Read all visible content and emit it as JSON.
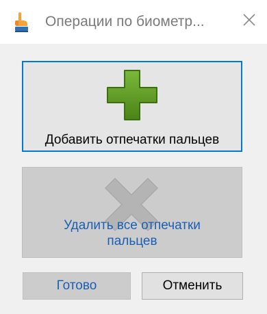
{
  "window": {
    "title": "Операции по биометр...",
    "app_icon": "finger-icon",
    "close_icon": "close-icon"
  },
  "buttons": {
    "add_fingerprints": {
      "label": "Добавить отпечатки пальцев",
      "icon": "plus-icon",
      "enabled": true
    },
    "remove_all_fingerprints": {
      "label": "Удалить все отпечатки пальцев",
      "icon": "cross-icon",
      "enabled": false
    },
    "done": {
      "label": "Готово",
      "enabled": false
    },
    "cancel": {
      "label": "Отменить",
      "enabled": true
    }
  },
  "colors": {
    "focus_border": "#0078d7",
    "plus_green": "#5a9a1f",
    "disabled_text": "#1a5fb4"
  }
}
